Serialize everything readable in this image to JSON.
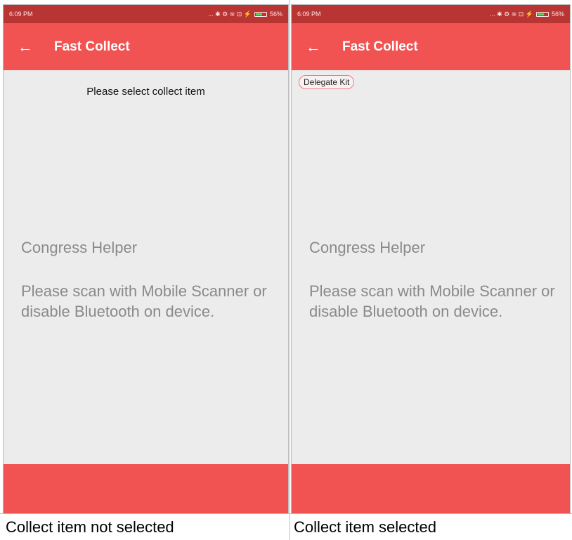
{
  "screens": [
    {
      "status_time": "6:09 PM",
      "status_icons": "... ✱ ⚙ ≋ ⊡ ⚡",
      "battery": "56%",
      "app_title": "Fast Collect",
      "prompt": "Please select collect item",
      "chip": "",
      "helper_title": "Congress Helper",
      "helper_message": "Please scan with Mobile Scanner or disable Bluetooth on device.",
      "caption": "Collect item not selected"
    },
    {
      "status_time": "6:09 PM",
      "status_icons": "... ✱ ⚙ ≋ ⊡ ⚡",
      "battery": "56%",
      "app_title": "Fast Collect",
      "prompt": "",
      "chip": "Delegate Kit",
      "helper_title": "Congress Helper",
      "helper_message": "Please scan with Mobile Scanner or disable Bluetooth on device.",
      "caption": "Collect item selected"
    }
  ],
  "icons": {
    "back": "arrow-left-icon",
    "battery": "battery-icon"
  },
  "colors": {
    "appbar": "#f15252",
    "statusbar": "#b93533",
    "background": "#ececec"
  }
}
